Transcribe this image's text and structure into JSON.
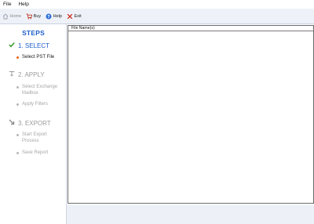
{
  "menu": {
    "file": "File",
    "help": "Help"
  },
  "toolbar": {
    "home": "Home",
    "buy": "Buy",
    "help": "Help",
    "exit": "Exit"
  },
  "steps": {
    "title": "STEPS",
    "select": {
      "label": "1. SELECT",
      "items": [
        "Select PST File"
      ]
    },
    "apply": {
      "label": "2. APPLY",
      "items": [
        "Select Exchange Mailbox",
        "Apply Filters"
      ]
    },
    "export": {
      "label": "3. EXPORT",
      "items": [
        "Start Export Process",
        "Save Report"
      ]
    }
  },
  "list": {
    "column_header": "File Name(s)"
  },
  "colors": {
    "accent": "#1f5ec9",
    "check": "#3a9a2a",
    "active_dot": "#e8641c",
    "toolbar_bg": "#eef2f8"
  }
}
